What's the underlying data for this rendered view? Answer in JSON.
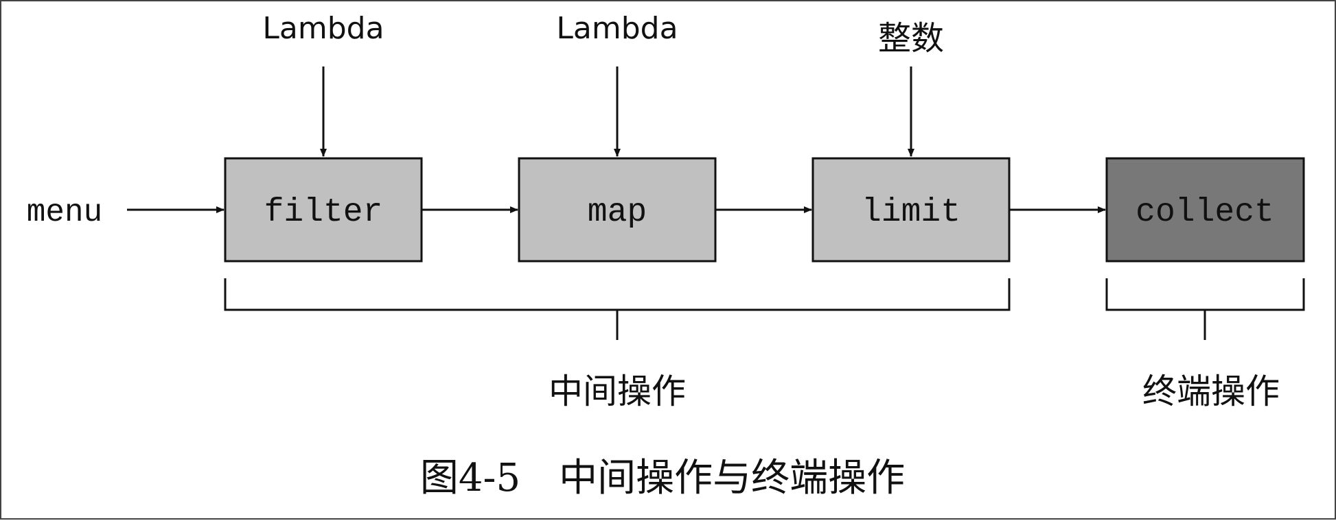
{
  "diagram": {
    "source_label": "menu",
    "inputs": [
      {
        "label": "Lambda"
      },
      {
        "label": "Lambda"
      },
      {
        "label": "整数"
      }
    ],
    "operations": [
      {
        "label": "filter",
        "kind": "intermediate"
      },
      {
        "label": "map",
        "kind": "intermediate"
      },
      {
        "label": "limit",
        "kind": "intermediate"
      },
      {
        "label": "collect",
        "kind": "terminal"
      }
    ],
    "groups": {
      "intermediate": "中间操作",
      "terminal": "终端操作"
    },
    "caption": "图4-5　中间操作与终端操作",
    "colors": {
      "intermediate_fill": "#c0c0c0",
      "terminal_fill": "#787878",
      "stroke": "#111111",
      "background": "#ffffff"
    }
  }
}
